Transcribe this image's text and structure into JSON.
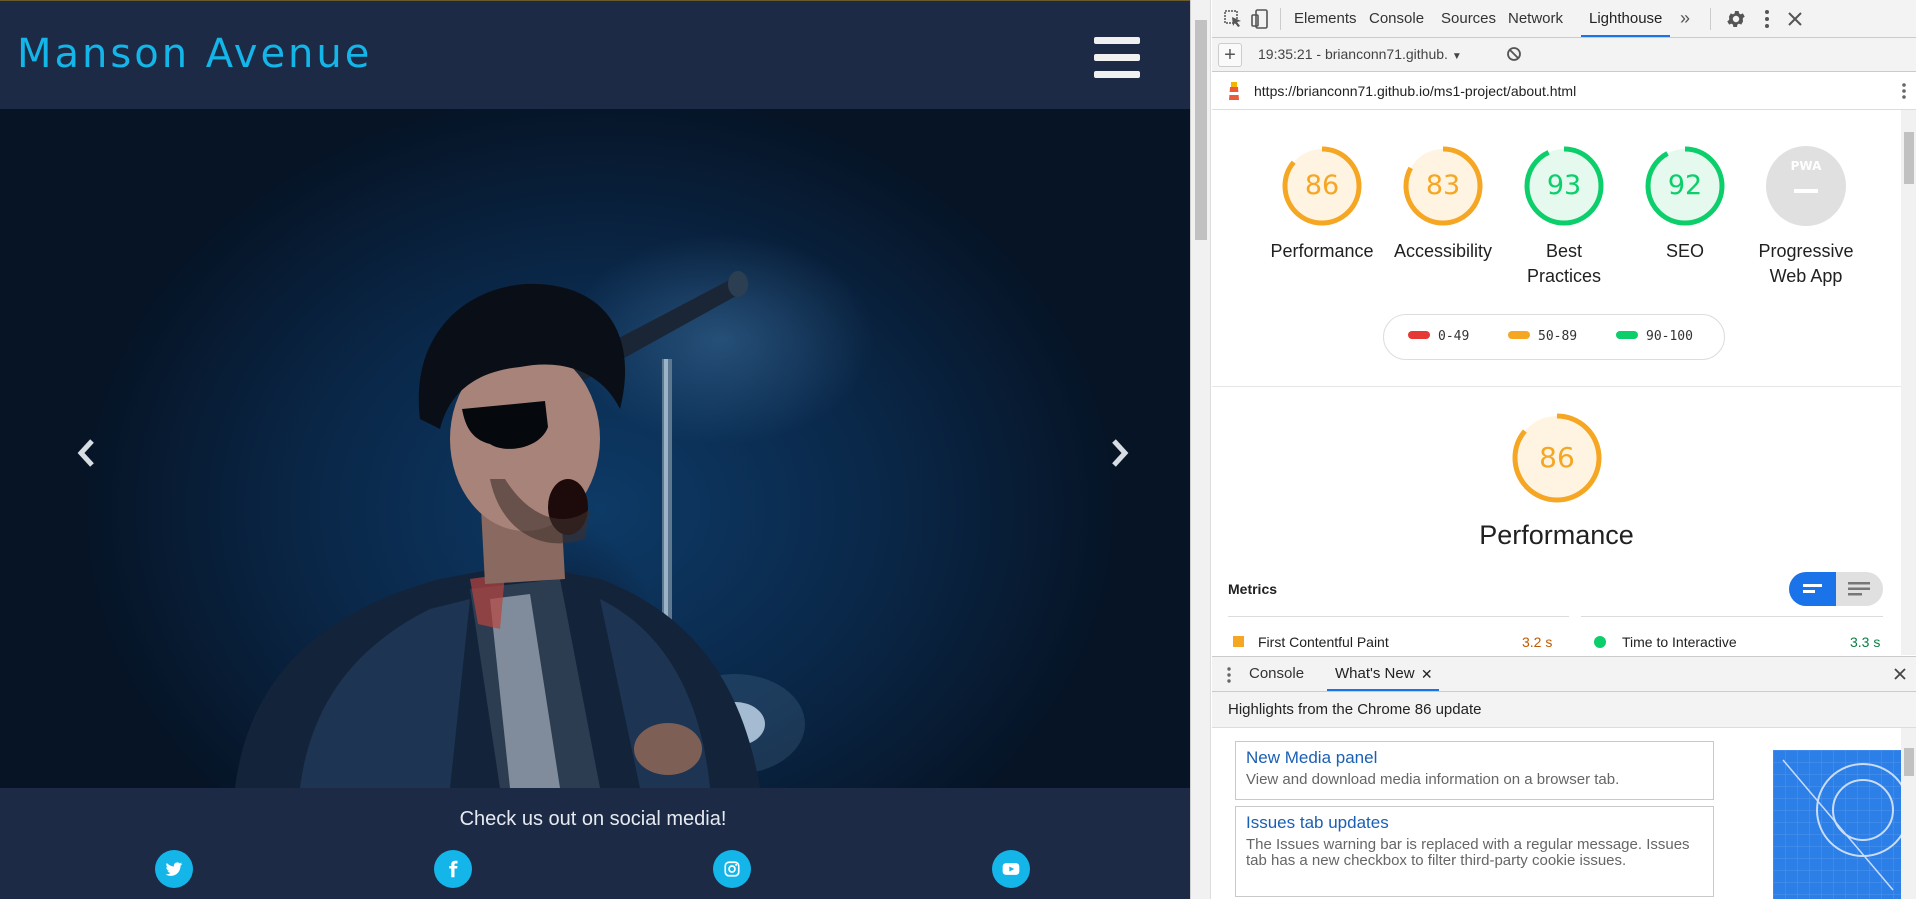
{
  "site": {
    "brand": "Manson Avenue",
    "social": {
      "title": "Check us out on social media!",
      "links": [
        {
          "icon": "twitter-icon"
        },
        {
          "icon": "facebook-icon"
        },
        {
          "icon": "instagram-icon"
        },
        {
          "icon": "youtube-icon"
        }
      ]
    },
    "colors": {
      "background": "#1c2a45",
      "accent": "#14b5e8"
    }
  },
  "devtools": {
    "tabs": [
      "Elements",
      "Console",
      "Sources",
      "Network",
      "Lighthouse"
    ],
    "active_tab": "Lighthouse",
    "report_select": "19:35:21 - brianconn71.github.",
    "url": "https://brianconn71.github.io/ms1-project/about.html",
    "categories": [
      {
        "score": "86",
        "label": "Performance",
        "status": "average"
      },
      {
        "score": "83",
        "label": "Accessibility",
        "status": "average"
      },
      {
        "score": "93",
        "label": "Best Practices",
        "status": "pass"
      },
      {
        "score": "92",
        "label": "SEO",
        "status": "pass"
      },
      {
        "score": "PWA",
        "label": "Progressive Web App",
        "status": "na"
      }
    ],
    "legend": [
      {
        "range": "0-49",
        "color": "#e53935"
      },
      {
        "range": "50-89",
        "color": "#f5a623"
      },
      {
        "range": "90-100",
        "color": "#0cce6b"
      }
    ],
    "performance": {
      "score": "86",
      "title": "Performance"
    },
    "metrics_heading": "Metrics",
    "metrics": [
      {
        "name": "First Contentful Paint",
        "value": "3.2 s",
        "status": "average"
      },
      {
        "name": "Time to Interactive",
        "value": "3.3 s",
        "status": "pass"
      }
    ],
    "drawer": {
      "tabs": [
        "Console",
        "What's New"
      ],
      "active_tab": "What's New",
      "highlights": "Highlights from the Chrome 86 update",
      "cards": [
        {
          "title": "New Media panel",
          "desc": "View and download media information on a browser tab."
        },
        {
          "title": "Issues tab updates",
          "desc": "The Issues warning bar is replaced with a regular message. Issues tab has a new checkbox to filter third-party cookie issues."
        }
      ]
    },
    "colors": {
      "average": "#f5a623",
      "pass": "#0cce6b",
      "fail": "#e53935",
      "link": "#1a5fb4",
      "tab_active": "#1a73e8"
    }
  }
}
